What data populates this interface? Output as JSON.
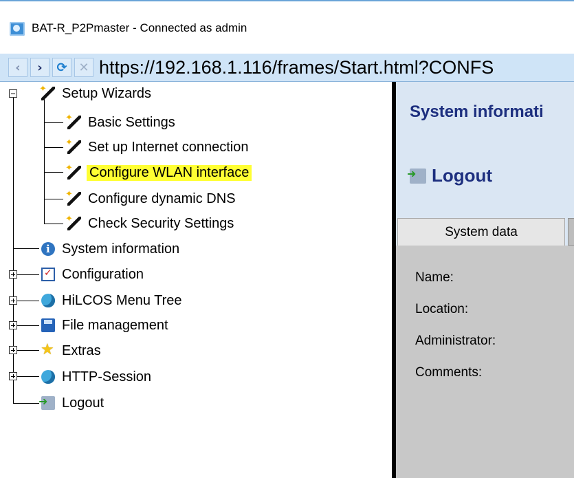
{
  "window": {
    "title": "BAT-R_P2Pmaster - Connected as admin"
  },
  "nav": {
    "address": "https://192.168.1.116/frames/Start.html?CONFS"
  },
  "tree": {
    "items": [
      {
        "label": "Setup Wizards"
      },
      {
        "label": "Basic Settings"
      },
      {
        "label": "Set up Internet connection"
      },
      {
        "label": "Configure WLAN interface"
      },
      {
        "label": "Configure dynamic DNS"
      },
      {
        "label": "Check Security Settings"
      },
      {
        "label": "System information"
      },
      {
        "label": "Configuration"
      },
      {
        "label": "HiLCOS Menu Tree"
      },
      {
        "label": "File management"
      },
      {
        "label": "Extras"
      },
      {
        "label": "HTTP-Session"
      },
      {
        "label": "Logout"
      }
    ],
    "highlight_color": "#ffff33"
  },
  "panel": {
    "title": "System informati",
    "logout": "Logout",
    "tab_active": "System data",
    "fields": [
      "Name:",
      "Location:",
      "Administrator:",
      "Comments:"
    ]
  }
}
